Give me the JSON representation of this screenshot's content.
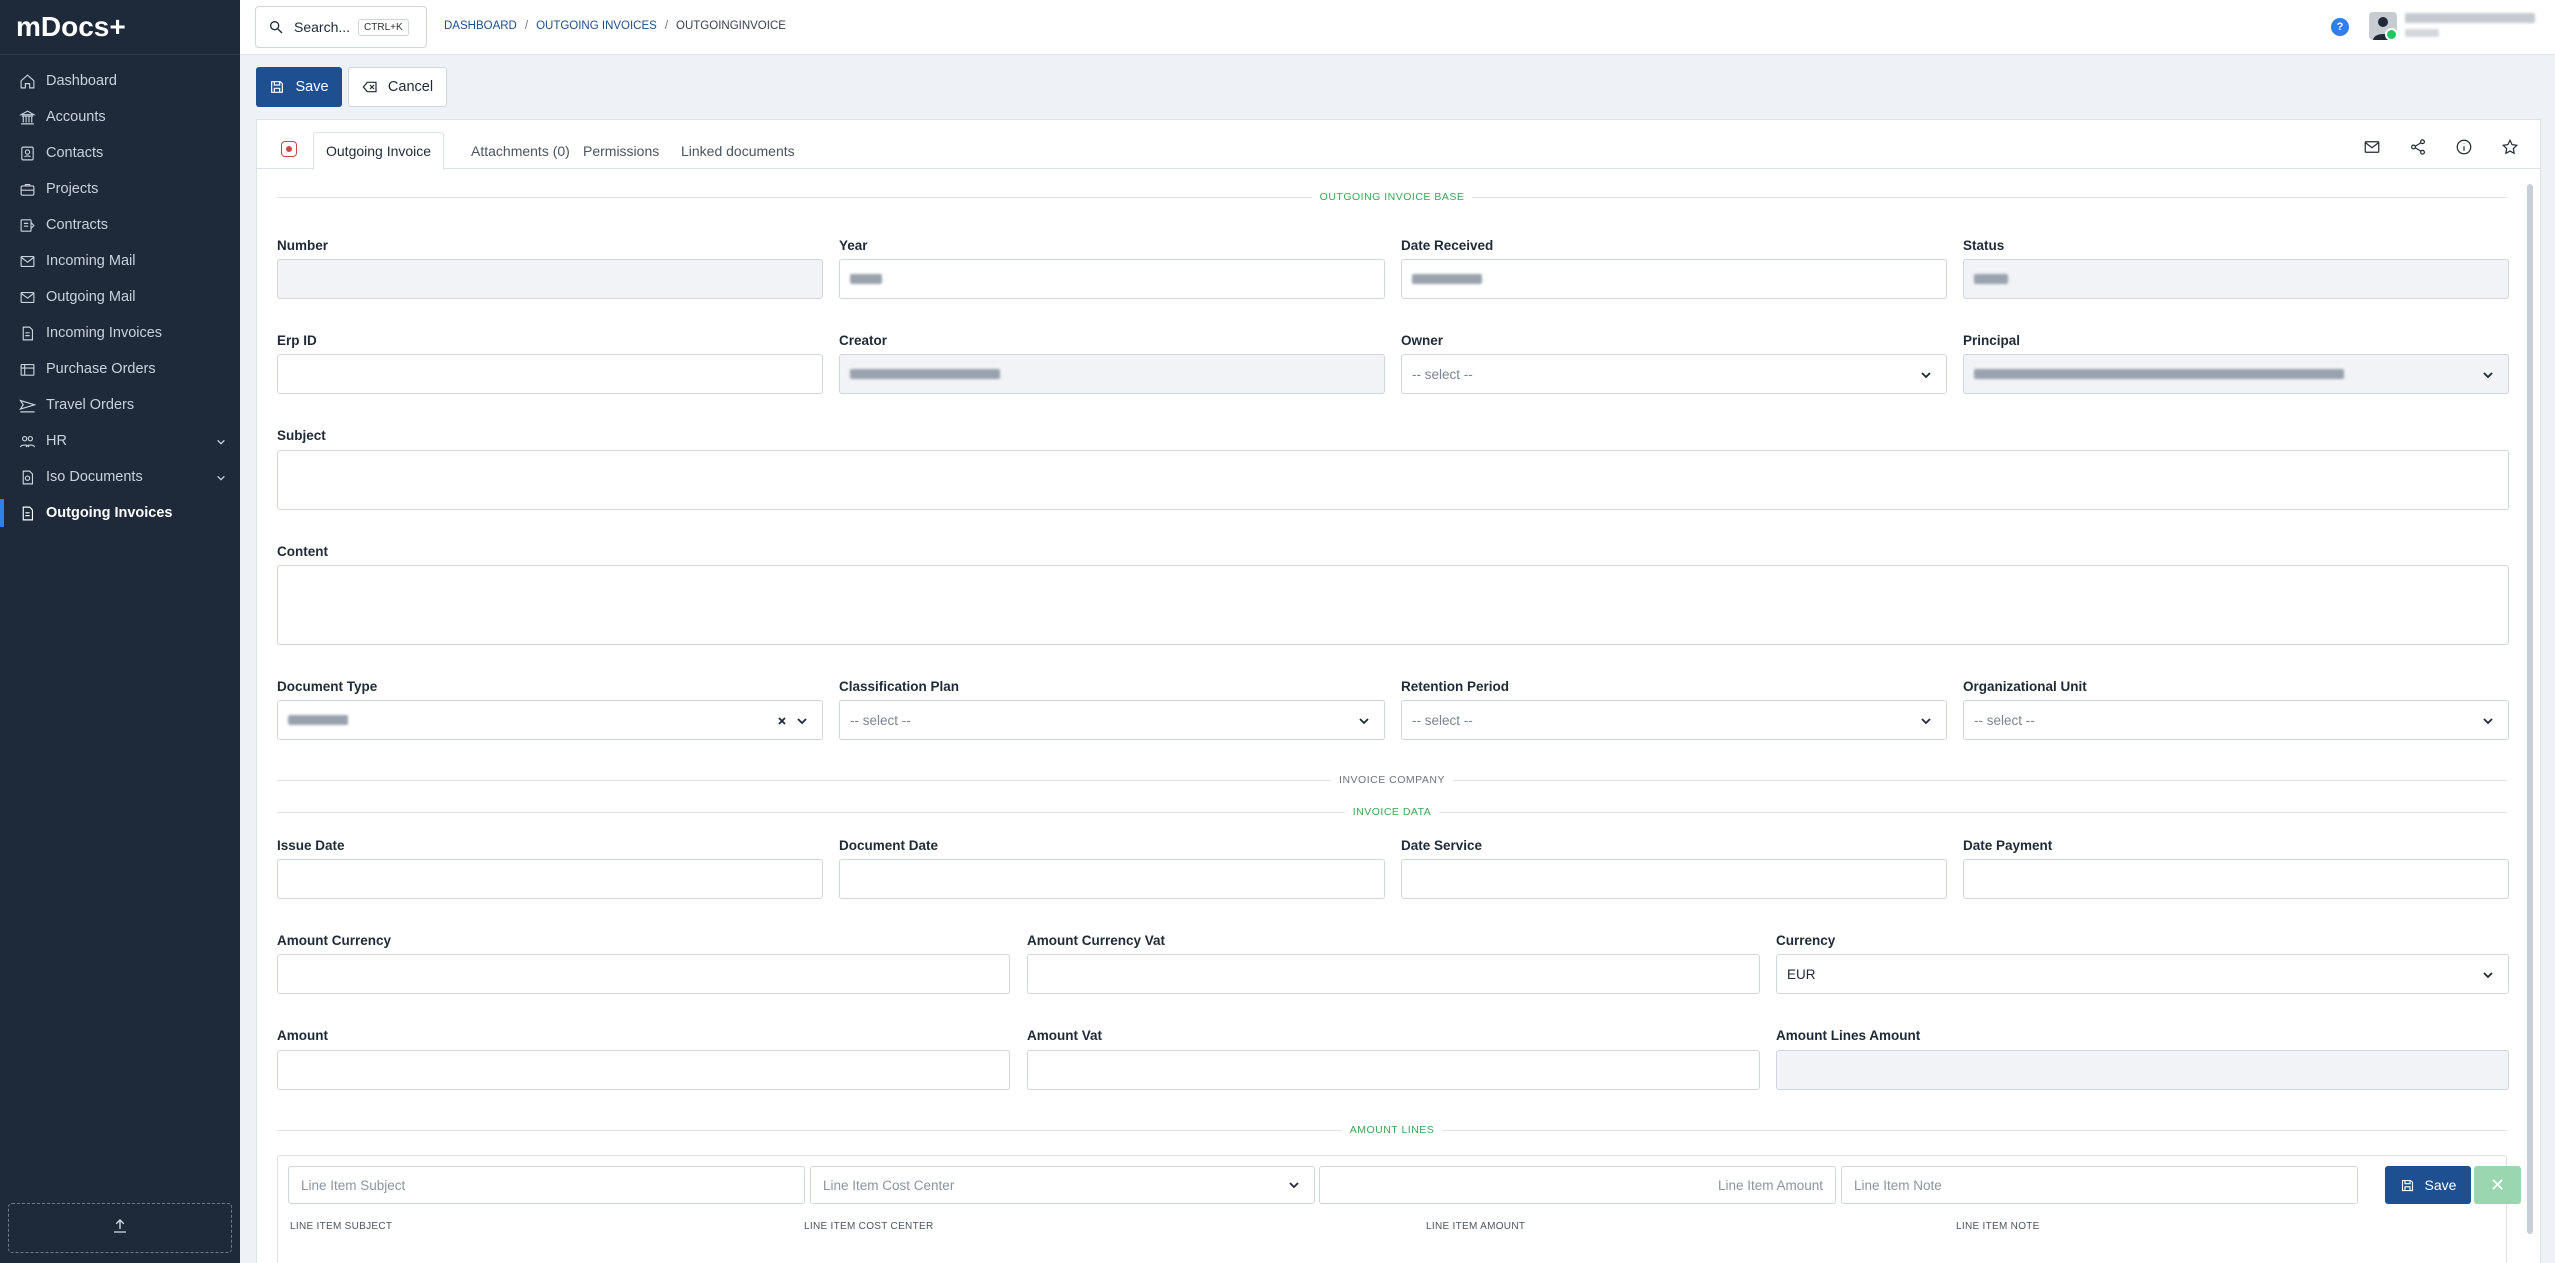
{
  "app": {
    "brand": "mDocs+"
  },
  "sidebar": {
    "items": [
      {
        "label": "Dashboard",
        "icon": "home-icon"
      },
      {
        "label": "Accounts",
        "icon": "bank-icon"
      },
      {
        "label": "Contacts",
        "icon": "contacts-icon"
      },
      {
        "label": "Projects",
        "icon": "briefcase-icon"
      },
      {
        "label": "Contracts",
        "icon": "contract-icon"
      },
      {
        "label": "Incoming Mail",
        "icon": "mail-in-icon"
      },
      {
        "label": "Outgoing Mail",
        "icon": "mail-out-icon"
      },
      {
        "label": "Incoming Invoices",
        "icon": "invoice-icon"
      },
      {
        "label": "Purchase Orders",
        "icon": "cart-icon"
      },
      {
        "label": "Travel Orders",
        "icon": "plane-icon"
      },
      {
        "label": "HR",
        "icon": "people-icon",
        "expandable": true
      },
      {
        "label": "Iso Documents",
        "icon": "iso-icon",
        "expandable": true
      },
      {
        "label": "Outgoing Invoices",
        "icon": "document-icon",
        "active": true
      }
    ],
    "upload_icon": "upload-icon"
  },
  "topbar": {
    "search_label": "Search...",
    "shortcut": "CTRL+K",
    "breadcrumb": [
      "DASHBOARD",
      "OUTGOING INVOICES",
      "OUTGOINGINVOICE"
    ],
    "help_label": "?"
  },
  "toolbar": {
    "save_label": "Save",
    "cancel_label": "Cancel"
  },
  "tabs": [
    {
      "label": "Outgoing Invoice",
      "active": true
    },
    {
      "label": "Attachments (0)"
    },
    {
      "label": "Permissions"
    },
    {
      "label": "Linked documents"
    }
  ],
  "sections": {
    "base": "OUTGOING INVOICE BASE",
    "company": "INVOICE COMPANY",
    "data": "INVOICE DATA",
    "lines": "AMOUNT LINES"
  },
  "fields": {
    "number": {
      "label": "Number"
    },
    "year": {
      "label": "Year"
    },
    "date_received": {
      "label": "Date Received"
    },
    "status": {
      "label": "Status"
    },
    "erp_id": {
      "label": "Erp ID"
    },
    "creator": {
      "label": "Creator"
    },
    "owner": {
      "label": "Owner",
      "value": "-- select --"
    },
    "principal": {
      "label": "Principal"
    },
    "subject": {
      "label": "Subject"
    },
    "content": {
      "label": "Content"
    },
    "document_type": {
      "label": "Document Type"
    },
    "classification_plan": {
      "label": "Classification Plan",
      "value": "-- select --"
    },
    "retention_period": {
      "label": "Retention Period",
      "value": "-- select --"
    },
    "organizational_unit": {
      "label": "Organizational Unit",
      "value": "-- select --"
    },
    "issue_date": {
      "label": "Issue Date"
    },
    "document_date": {
      "label": "Document Date"
    },
    "date_service": {
      "label": "Date Service"
    },
    "date_payment": {
      "label": "Date Payment"
    },
    "amount_currency": {
      "label": "Amount Currency"
    },
    "amount_currency_vat": {
      "label": "Amount Currency Vat"
    },
    "currency": {
      "label": "Currency",
      "value": "EUR"
    },
    "amount": {
      "label": "Amount"
    },
    "amount_vat": {
      "label": "Amount Vat"
    },
    "amount_lines_amount": {
      "label": "Amount Lines Amount"
    }
  },
  "lines": {
    "subject_placeholder": "Line Item Subject",
    "cost_center_placeholder": "Line Item Cost Center",
    "amount_placeholder": "Line Item Amount",
    "note_placeholder": "Line Item Note",
    "save_label": "Save",
    "cancel_glyph": "✕",
    "columns": [
      "LINE ITEM SUBJECT",
      "LINE ITEM COST CENTER",
      "LINE ITEM AMOUNT",
      "LINE ITEM NOTE"
    ]
  }
}
